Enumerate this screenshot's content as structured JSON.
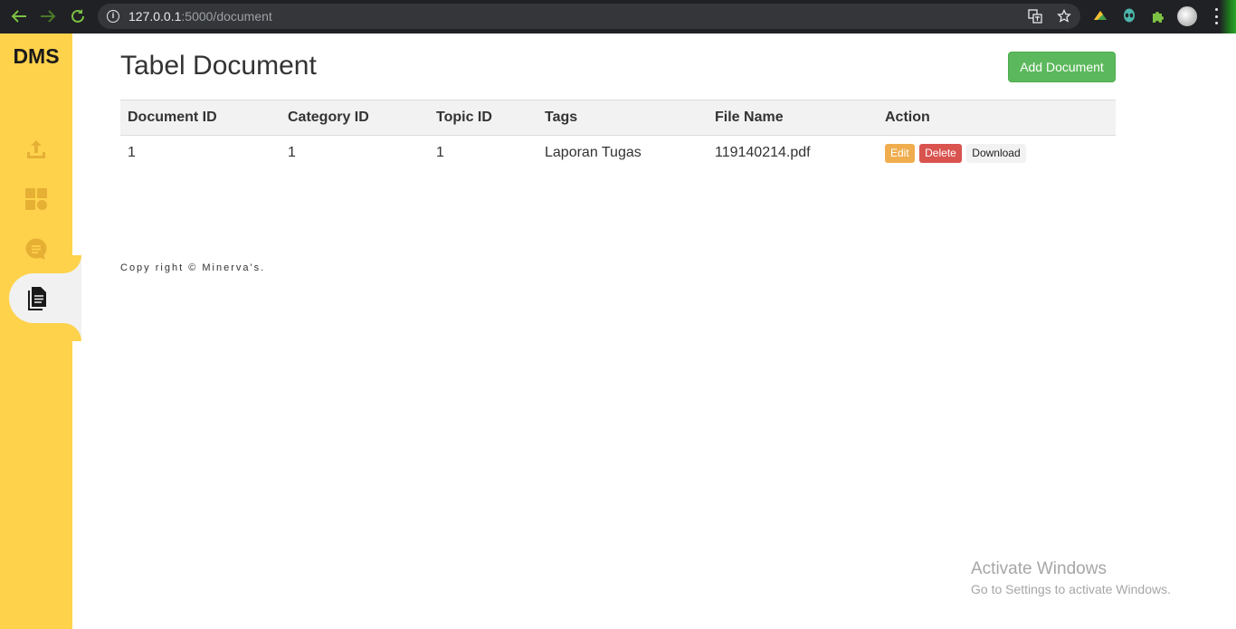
{
  "browser": {
    "url_host": "127.0.0.1",
    "url_path": ":5000/document"
  },
  "sidebar": {
    "brand": "DMS",
    "items": [
      {
        "icon": "upload-icon",
        "active": false
      },
      {
        "icon": "dashboard-icon",
        "active": false
      },
      {
        "icon": "chat-icon",
        "active": false
      },
      {
        "icon": "document-icon",
        "active": true
      }
    ],
    "accent": "#ffd24c"
  },
  "main": {
    "title": "Tabel Document",
    "add_button": "Add Document",
    "table": {
      "headers": [
        "Document ID",
        "Category ID",
        "Topic ID",
        "Tags",
        "File Name",
        "Action"
      ],
      "rows": [
        {
          "document_id": "1",
          "category_id": "1",
          "topic_id": "1",
          "tags": "Laporan Tugas",
          "file_name": "119140214.pdf"
        }
      ],
      "actions": {
        "edit": "Edit",
        "delete": "Delete",
        "download": "Download"
      }
    },
    "footer": "Copy right © Minerva's."
  },
  "watermark": {
    "title": "Activate Windows",
    "subtitle": "Go to Settings to activate Windows."
  },
  "colors": {
    "add_button": "#5cb85c",
    "edit_button": "#f0ad4e",
    "delete_button": "#d9534f"
  }
}
